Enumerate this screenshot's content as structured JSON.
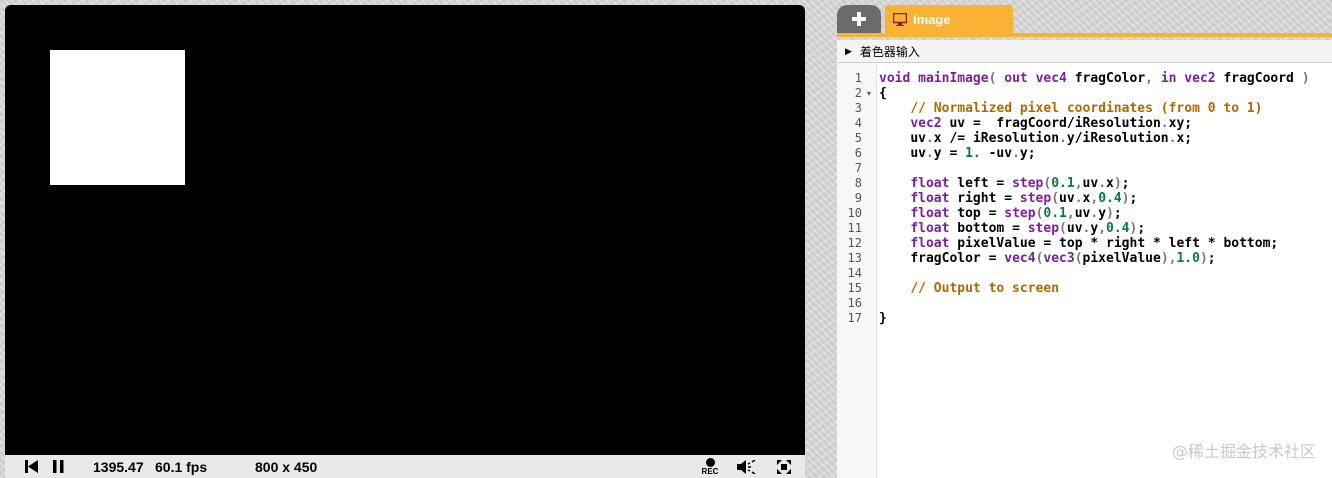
{
  "player": {
    "time": "1395.47",
    "fps": "60.1 fps",
    "resolution": "800 x 450",
    "rec_label": "REC"
  },
  "tabs": {
    "add_symbol": "+",
    "image_label": "Image"
  },
  "inputs_label": "着色器输入",
  "code": {
    "line_numbers": [
      "1",
      "2",
      "3",
      "4",
      "5",
      "6",
      "7",
      "8",
      "9",
      "10",
      "11",
      "12",
      "13",
      "14",
      "15",
      "16",
      "17"
    ],
    "lines": [
      "void mainImage( out vec4 fragColor, in vec2 fragCoord )",
      "{",
      "    // Normalized pixel coordinates (from 0 to 1)",
      "    vec2 uv =  fragCoord/iResolution.xy;",
      "    uv.x /= iResolution.y/iResolution.x;",
      "    uv.y = 1. -uv.y;",
      "",
      "    float left = step(0.1,uv.x);",
      "    float right = step(uv.x,0.4);",
      "    float top = step(0.1,uv.y);",
      "    float bottom = step(uv.y,0.4);",
      "    float pixelValue = top * right * left * bottom;",
      "    fragColor = vec4(vec3(pixelValue),1.0);",
      "",
      "    // Output to screen",
      "",
      "}"
    ]
  },
  "watermark": "@稀土掘金技术社区",
  "colors": {
    "tab_accent": "#f9b233",
    "keyword": "#7a1f9e",
    "comment": "#b06a00",
    "number": "#0a7a3d"
  },
  "icons": [
    "rewind-icon",
    "pause-icon",
    "record-icon",
    "volume-icon",
    "fullscreen-icon",
    "monitor-icon",
    "plus-icon",
    "triangle-right-icon"
  ]
}
